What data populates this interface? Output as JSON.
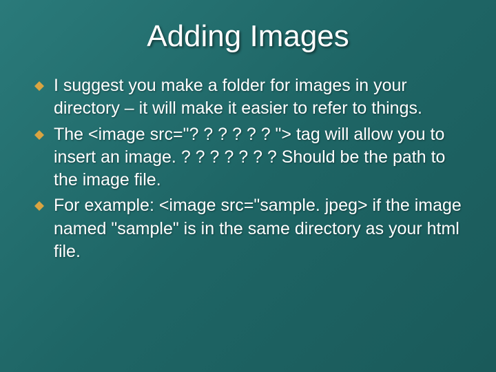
{
  "title": "Adding Images",
  "bullets": [
    {
      "text": "I suggest you make a folder for images in your directory – it will make it easier to refer to things."
    },
    {
      "text": "The <image src=\"? ? ? ? ? ? \"> tag will allow you to insert an image.  ? ? ? ? ? ? ? Should be the path to the image file."
    },
    {
      "text": "For example: <image src=\"sample. jpeg> if the image named \"sample\" is in the same directory as your html file."
    }
  ],
  "colors": {
    "bullet_fill": "#d9a441"
  }
}
